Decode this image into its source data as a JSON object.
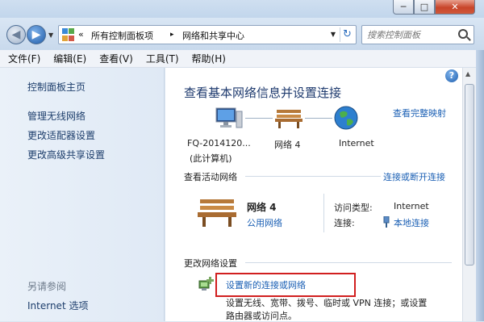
{
  "window": {
    "min_label": "─",
    "max_label": "□",
    "close_label": "✕"
  },
  "address": {
    "overflow": "«",
    "crumbs": [
      "所有控制面板项",
      "网络和共享中心"
    ],
    "separator": "▸",
    "search_placeholder": "搜索控制面板"
  },
  "menu": [
    "文件(F)",
    "编辑(E)",
    "查看(V)",
    "工具(T)",
    "帮助(H)"
  ],
  "sidebar": {
    "items": [
      "控制面板主页",
      "管理无线网络",
      "更改适配器设置",
      "更改高级共享设置"
    ],
    "see_also_title": "另请参阅",
    "see_also_items": [
      "Internet 选项"
    ]
  },
  "main": {
    "title": "查看基本网络信息并设置连接",
    "view_full_map": "查看完整映射",
    "map_nodes": {
      "computer_name": "FQ-2014120...",
      "computer_sub": "(此计算机)",
      "network": "网络  4",
      "internet": "Internet"
    },
    "active_networks_title": "查看活动网络",
    "connect_disconnect": "连接或断开连接",
    "network_name": "网络  4",
    "network_type": "公用网络",
    "access_type_label": "访问类型:",
    "access_type_value": "Internet",
    "connections_label": "连接:",
    "connections_value": "本地连接",
    "change_settings_title": "更改网络设置",
    "setup_link": "设置新的连接或网络",
    "setup_desc_1": "设置无线、宽带、拨号、临时或 VPN 连接；或设置",
    "setup_desc_2": "路由器或访问点。"
  },
  "colors": {
    "link": "#1a5fb4",
    "heading": "#1e3a6e",
    "highlight": "#d11f1f"
  }
}
